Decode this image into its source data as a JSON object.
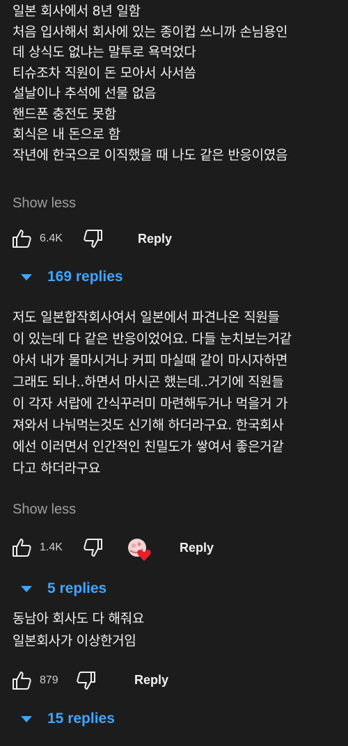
{
  "comments": [
    {
      "lines": [
        "일본 회사에서 8년 일함",
        "처음 입사해서 회사에 있는 종이컵 쓰니까 손님용인",
        "데 상식도 없냐는 말투로 욕먹었다",
        "티슈조차 직원이 돈 모아서 사서씀",
        "설날이나 추석에 선물 없음",
        "핸드폰 충전도 못함",
        "회식은 내 돈으로 함",
        "작년에 한국으로 이직했을 때 나도 같은 반응이였음"
      ],
      "show_less": "Show less",
      "likes": "6.4K",
      "reply_label": "Reply",
      "replies_label": "169 replies"
    },
    {
      "lines": [
        "저도 일본합작회사여서 일본에서 파견나온 직원들",
        "이 있는데 다 같은 반응이었어요. 다들 눈치보는거같",
        "아서 내가 물마시거나 커피 마실때 같이 마시자하면",
        "그래도 되나..하면서 마시곤 했는데..거기에 직원들",
        "이 각자 서랍에 간식꾸러미 마련해두거나 먹을거 가",
        "져와서 나눠먹는것도 신기해 하더라구요. 한국회사",
        "에선 이러면서 인간적인 친밀도가 쌓여서 좋은거같",
        "다고 하더라구요"
      ],
      "show_less": "Show less",
      "likes": "1.4K",
      "reply_label": "Reply",
      "replies_label": "5 replies"
    },
    {
      "lines": [
        "동남아 회사도 다 해줘요",
        "일본회사가 이상한거임"
      ],
      "likes": "879",
      "reply_label": "Reply",
      "replies_label": "15 replies"
    }
  ],
  "icons": {
    "like": "thumbs-up-outline-icon",
    "dislike": "thumbs-down-outline-icon",
    "creator_heart": "creator-heart-badge-icon",
    "expand": "caret-down-icon"
  },
  "colors": {
    "background": "#1c1c1c",
    "text": "#f1f1f1",
    "muted": "#9e9e9e",
    "link": "#3ea6ff",
    "heart": "#e5202b"
  }
}
